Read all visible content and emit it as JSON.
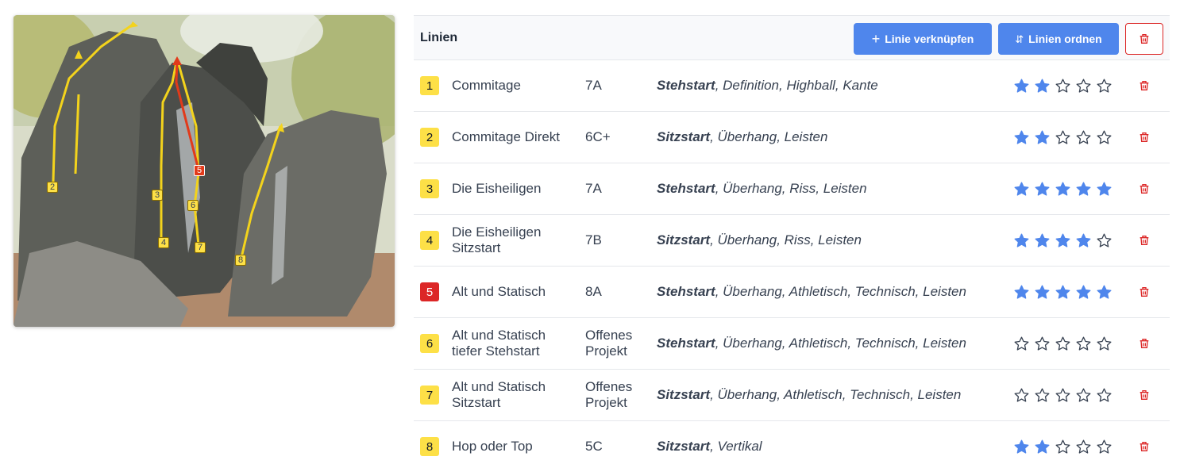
{
  "header": {
    "title": "Linien",
    "link_button": "Linie verknüpfen",
    "order_button": "Linien ordnen"
  },
  "colors": {
    "accent": "#4f86ec",
    "badge_yellow": "#fde047",
    "badge_red": "#dc2626",
    "star_filled": "#4f86ec",
    "delete_red": "#dc2626"
  },
  "photo": {
    "alt": "boulder-topo",
    "labels": [
      "2",
      "3",
      "4",
      "5",
      "6",
      "7",
      "8"
    ]
  },
  "lines": [
    {
      "num": "1",
      "color": "yellow",
      "name": "Commitage",
      "grade": "7A",
      "start": "Stehstart",
      "tags": ", Definition, Highball, Kante",
      "rating": 2
    },
    {
      "num": "2",
      "color": "yellow",
      "name": "Commitage Direkt",
      "grade": "6C+",
      "start": "Sitzstart",
      "tags": ", Überhang, Leisten",
      "rating": 2
    },
    {
      "num": "3",
      "color": "yellow",
      "name": "Die Eisheiligen",
      "grade": "7A",
      "start": "Stehstart",
      "tags": ", Überhang, Riss, Leisten",
      "rating": 5
    },
    {
      "num": "4",
      "color": "yellow",
      "name": "Die Eisheiligen Sitzstart",
      "grade": "7B",
      "start": "Sitzstart",
      "tags": ", Überhang, Riss, Leisten",
      "rating": 4
    },
    {
      "num": "5",
      "color": "red",
      "name": "Alt und Statisch",
      "grade": "8A",
      "start": "Stehstart",
      "tags": ", Überhang, Athletisch, Technisch, Leisten",
      "rating": 5
    },
    {
      "num": "6",
      "color": "yellow",
      "name": "Alt und Statisch tiefer Stehstart",
      "grade": "Offenes Projekt",
      "start": "Stehstart",
      "tags": ", Überhang, Athletisch, Technisch, Leisten",
      "rating": 0
    },
    {
      "num": "7",
      "color": "yellow",
      "name": "Alt und Statisch Sitzstart",
      "grade": "Offenes Projekt",
      "start": "Sitzstart",
      "tags": ", Überhang, Athletisch, Technisch, Leisten",
      "rating": 0
    },
    {
      "num": "8",
      "color": "yellow",
      "name": "Hop oder Top",
      "grade": "5C",
      "start": "Sitzstart",
      "tags": ", Vertikal",
      "rating": 2
    }
  ]
}
